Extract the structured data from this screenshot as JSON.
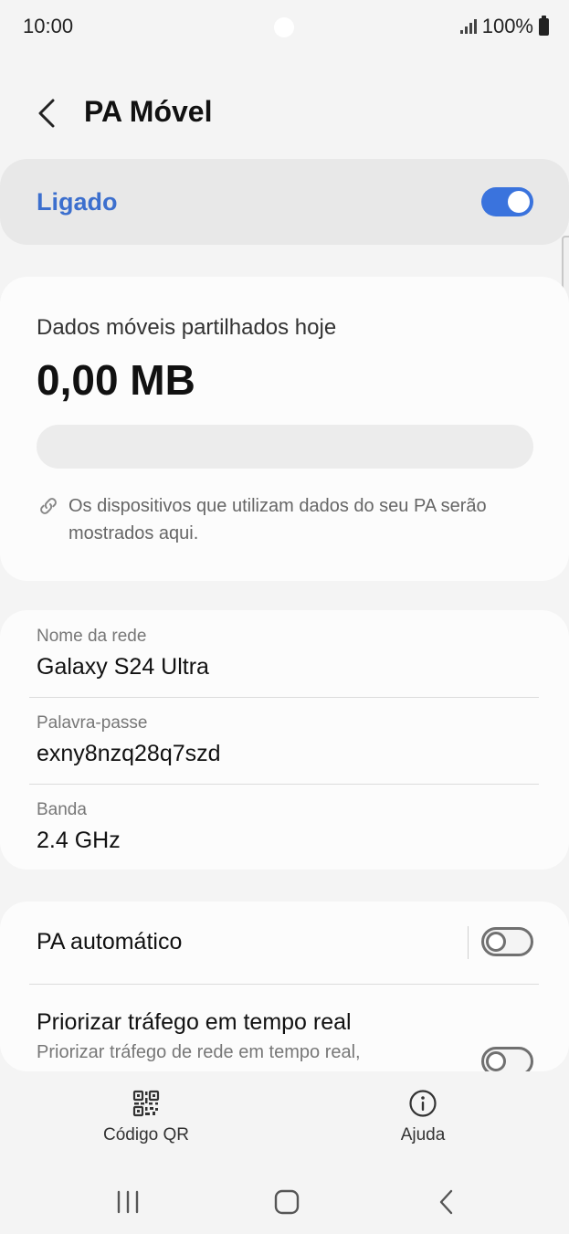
{
  "status_bar": {
    "time": "10:00",
    "battery_text": "100%"
  },
  "header": {
    "title": "PA Móvel"
  },
  "hotspot_toggle": {
    "label": "Ligado",
    "state": "on",
    "accent_color": "#3a73dd"
  },
  "usage": {
    "label": "Dados móveis partilhados hoje",
    "value": "0,00 MB",
    "progress_fraction": 0,
    "note": "Os dispositivos que utilizam dados do seu PA serão mostrados aqui."
  },
  "network": {
    "name_label": "Nome da rede",
    "name_value": "Galaxy S24 Ultra",
    "password_label": "Palavra-passe",
    "password_value": "exny8nzq28q7szd",
    "band_label": "Banda",
    "band_value": "2.4 GHz"
  },
  "settings": {
    "auto_hotspot_label": "PA automático",
    "auto_hotspot_state": "off",
    "realtime_title": "Priorizar tráfego em tempo real",
    "realtime_desc": "Priorizar tráfego de rede em tempo real,",
    "realtime_state": "off"
  },
  "bottom_actions": {
    "qr_label": "Código QR",
    "help_label": "Ajuda"
  },
  "icons": {
    "back": "chevron-left-icon",
    "link": "link-icon",
    "qr": "qr-code-icon",
    "help": "info-icon",
    "nav_recents": "recents-icon",
    "nav_home": "home-icon",
    "nav_back": "back-icon"
  }
}
